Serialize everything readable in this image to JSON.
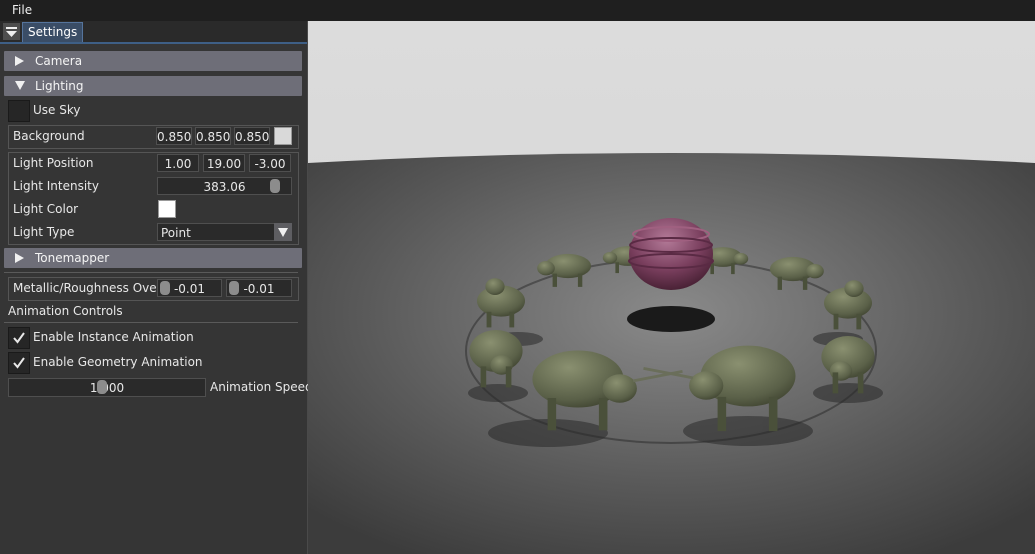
{
  "menubar": {
    "file_label": "File"
  },
  "panel": {
    "tab_label": "Settings",
    "camera_header": "Camera",
    "lighting_header": "Lighting",
    "use_sky_label": "Use Sky",
    "use_sky_checked": false,
    "background": {
      "label": "Background",
      "r": "0.850",
      "g": "0.850",
      "b": "0.850",
      "swatch_color": "#d9d9d9"
    },
    "light_position": {
      "label": "Light Position",
      "x": "1.00",
      "y": "19.00",
      "z": "-3.00"
    },
    "light_intensity": {
      "label": "Light Intensity",
      "value": "383.06"
    },
    "light_color": {
      "label": "Light Color",
      "swatch_color": "#ffffff"
    },
    "light_type": {
      "label": "Light Type",
      "value": "Point"
    },
    "tonemapper_header": "Tonemapper",
    "metallic_roughness": {
      "label": "Metallic/Roughness Ove",
      "metallic": "-0.01",
      "roughness": "-0.01"
    },
    "animation_controls_label": "Animation Controls",
    "enable_instance_animation": {
      "label": "Enable Instance Animation",
      "checked": true
    },
    "enable_geometry_animation": {
      "label": "Enable Geometry Animation",
      "checked": true
    },
    "animation_speed": {
      "label": "Animation Speed",
      "value": "1.000"
    }
  },
  "colors": {
    "accent": "#3e5f86",
    "header": "#6e6e78",
    "panel_bg": "#353535",
    "floor": "#5e5e5e",
    "sky": "#d9d9d9",
    "bull": "#5a6048",
    "sphere": "#7a3f5e"
  }
}
